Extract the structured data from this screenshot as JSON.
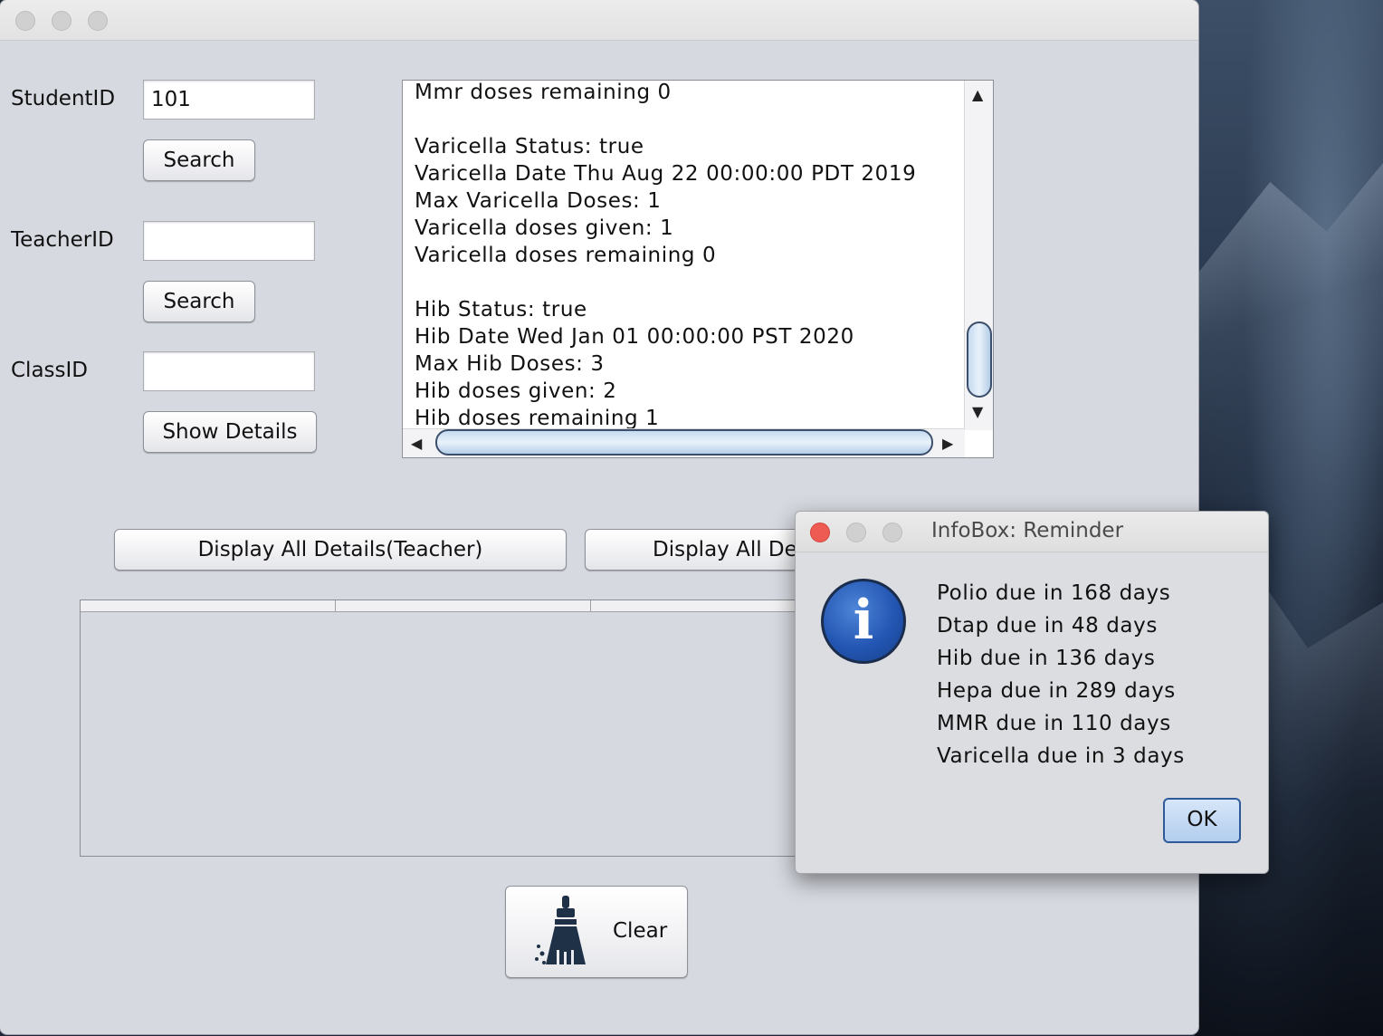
{
  "form": {
    "student_label": "StudentID",
    "student_value": "101",
    "search_label": "Search",
    "teacher_label": "TeacherID",
    "teacher_value": "",
    "class_label": "ClassID",
    "class_value": "",
    "show_details_label": "Show Details"
  },
  "details_text": "Mmr doses remaining 0\n\nVaricella Status: true\nVaricella Date Thu Aug 22 00:00:00 PDT 2019\nMax Varicella Doses: 1\nVaricella doses given: 1\nVaricella doses remaining 0\n\nHib Status: true\nHib Date Wed Jan 01 00:00:00 PST 2020\nMax Hib Doses: 3\nHib doses given: 2\nHib doses remaining 1",
  "buttons": {
    "display_teacher": "Display All Details(Teacher)",
    "display_other": "Display All De",
    "clear": "Clear"
  },
  "dialog": {
    "title": "InfoBox: Reminder",
    "messages": [
      "Polio due in 168 days",
      "Dtap due in 48 days",
      "Hib due in 136 days",
      "Hepa due in 289 days",
      "MMR due in 110 days",
      "Varicella due in 3 days"
    ],
    "ok_label": "OK"
  },
  "colors": {
    "close_red": "#ee5b52",
    "accent_blue": "#2e5a9a"
  },
  "icons": {
    "info": "info-icon",
    "broom": "broom-icon"
  }
}
